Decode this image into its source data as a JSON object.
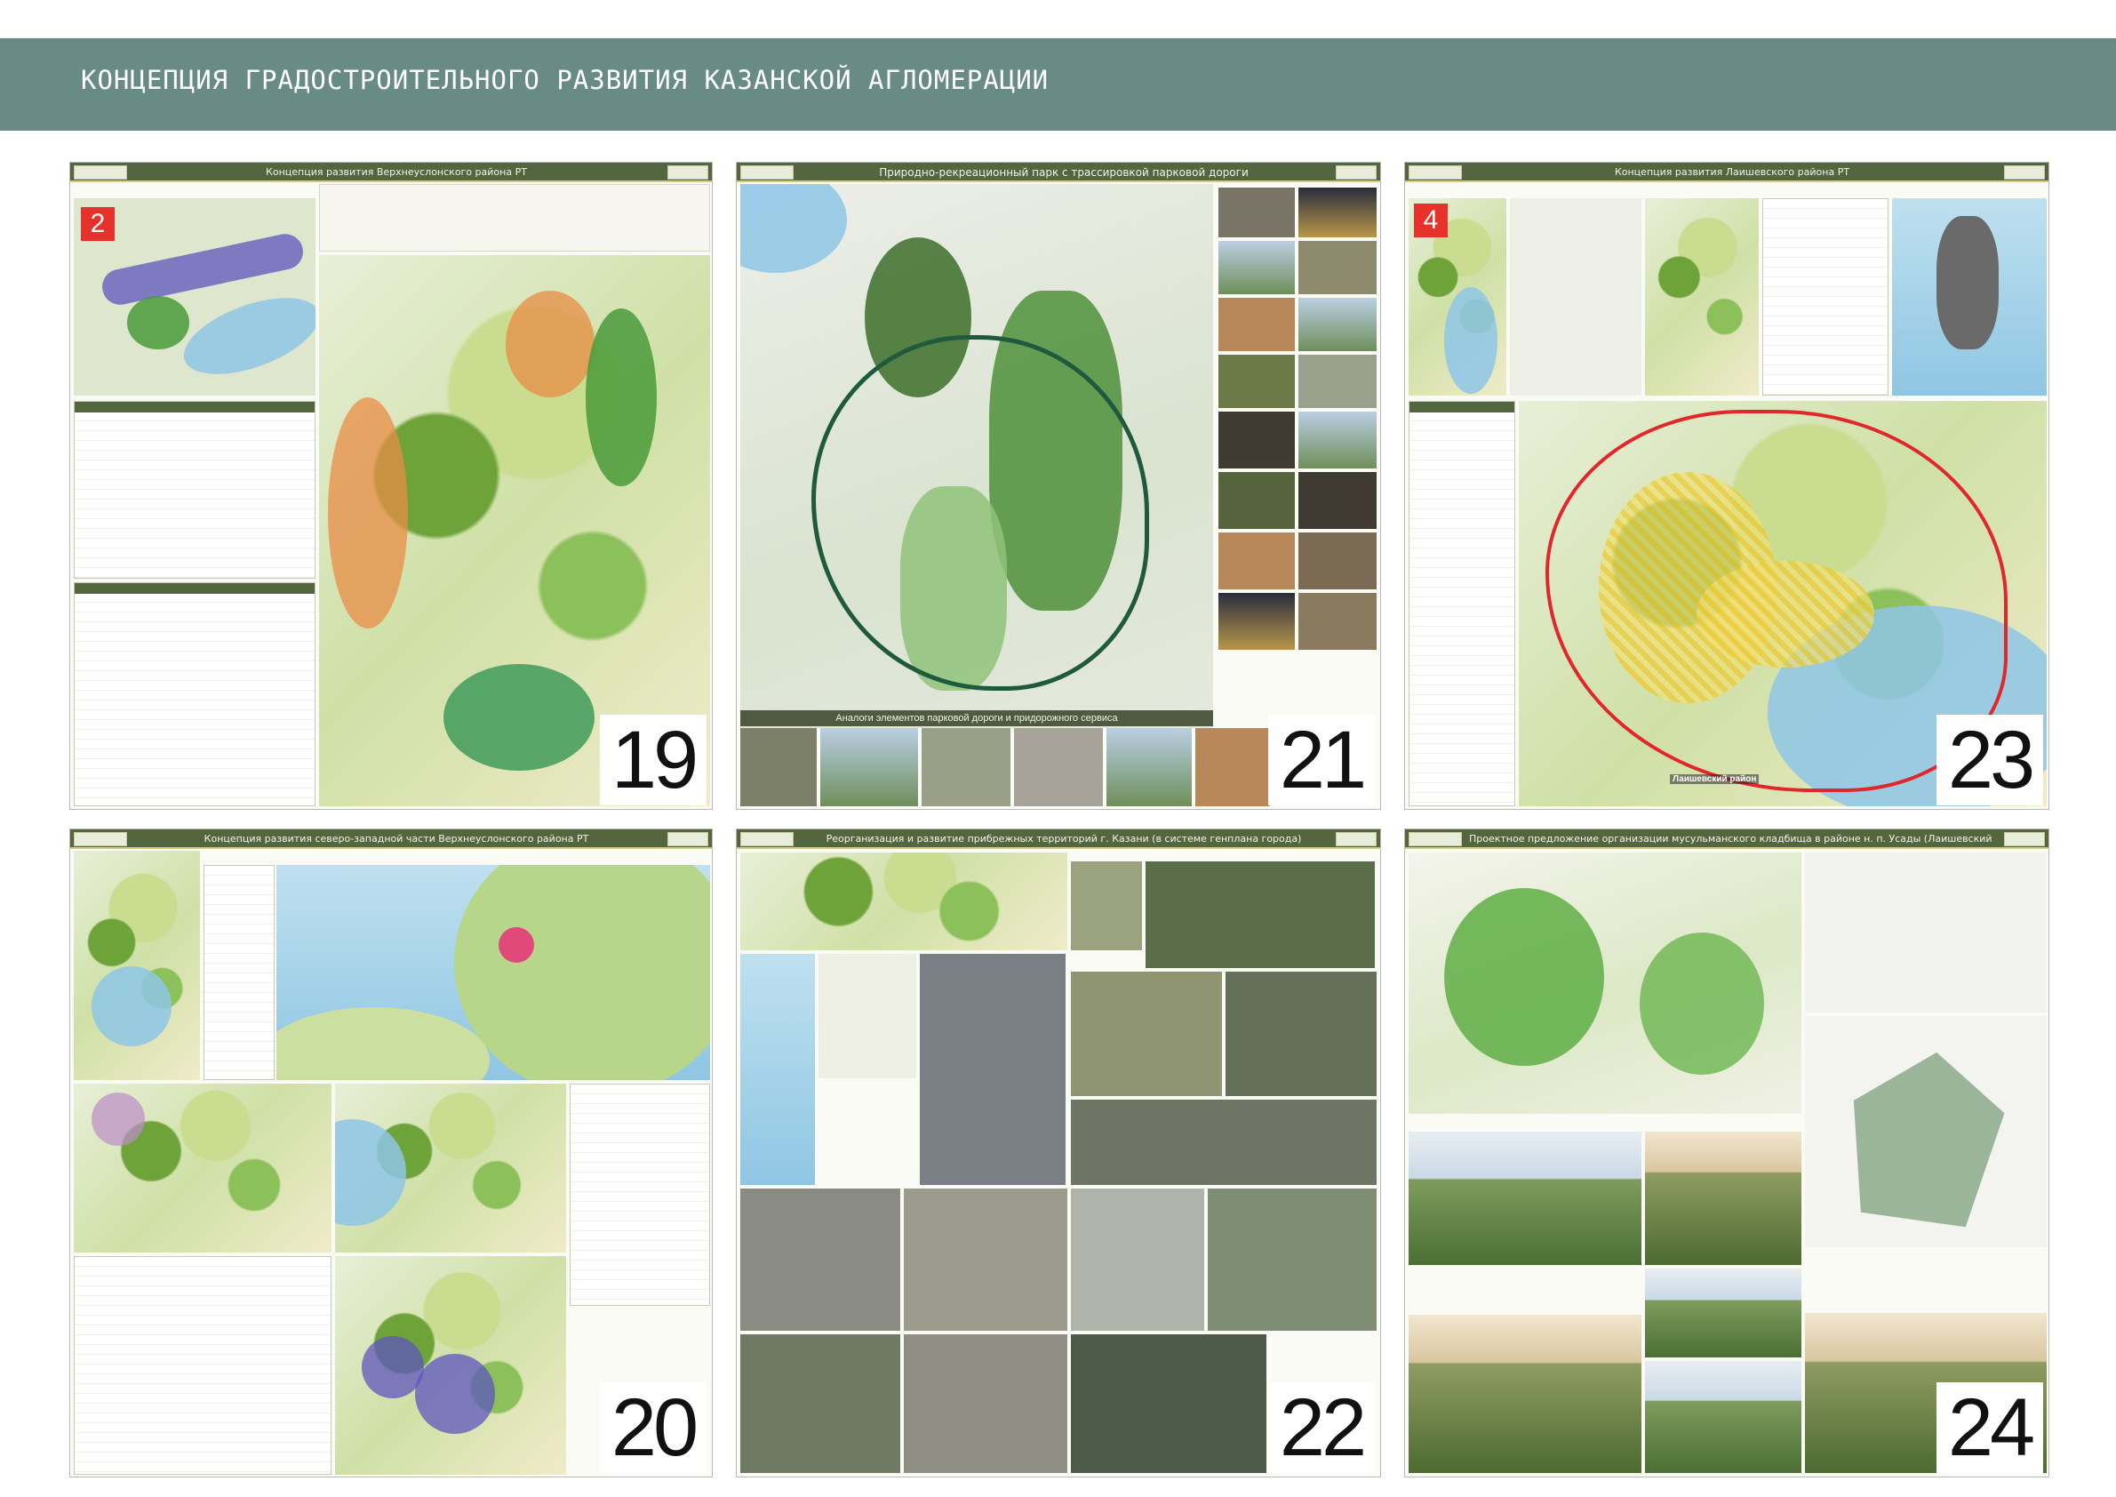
{
  "header": {
    "title": "КОНЦЕПЦИЯ ГРАДОСТРОИТЕЛЬНОГО РАЗВИТИЯ КАЗАНСКОЙ АГЛОМЕРАЦИИ"
  },
  "sheets": [
    {
      "number": "19",
      "title": "Концепция развития Верхнеуслонского района РТ",
      "badge": "2"
    },
    {
      "number": "21",
      "title": "Природно-рекреационный парк с трассировкой парковой дороги",
      "caption": "Аналоги элементов парковой дороги и придорожного сервиса"
    },
    {
      "number": "23",
      "title": "Концепция развития Лаишевского района РТ",
      "badge": "4",
      "map_label": "Лаишевский район"
    },
    {
      "number": "20",
      "title": "Концепция развития северо-западной части Верхнеуслонского района РТ"
    },
    {
      "number": "22",
      "title": "Реорганизация и развитие прибрежных территорий г. Казани (в системе генплана города)"
    },
    {
      "number": "24",
      "title": "Проектное предложение организации мусульманского кладбища в районе н. п. Усады (Лаишевский район)"
    }
  ],
  "colors": {
    "header_band": "#698b86",
    "sheet_bar": "#53663d",
    "badge_red": "#e7312b",
    "boundary_red": "#e0272b",
    "park_route": "#1f5a3d"
  }
}
